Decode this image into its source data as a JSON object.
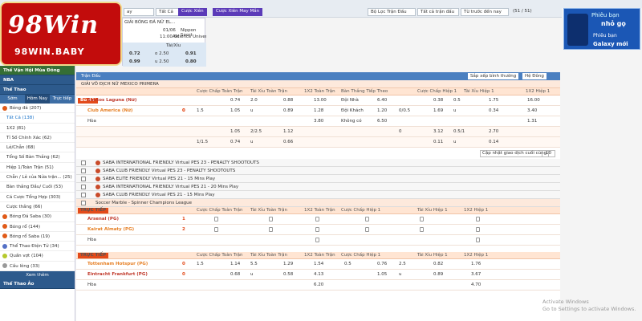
{
  "topbar": {
    "league_select": "Tất Cả",
    "btn_search": "Cược Xiên",
    "btn_mix": "Cược Xiên May Mắn",
    "filter_match": "Bộ Lọc Trận Đấu",
    "filter_all": "Tất cả trận đấu",
    "sort": "Từ trước đến nay",
    "count": "(51 / 51)",
    "label_ay": "ay"
  },
  "logo": {
    "text": "98Win",
    "domain": "98WIN.BABY"
  },
  "popup": {
    "league": "GIẢI BÓNG ĐÁ NỮ EL...",
    "date": "01/06",
    "time": "11:00AM",
    "team1": "Nippon Sport",
    "team2": "Science Universit...",
    "col2": "Tài/Xỉu",
    "r1a": "0.72",
    "r1b": "o 2.50",
    "r1c": "0.91",
    "r2a": "0.99",
    "r2b": "u 2.50",
    "r2c": "0.80"
  },
  "sidebar": {
    "h1": "Thế Vận Hội Mùa Đông",
    "h2": "NBA",
    "h3": "Thể Thao",
    "tabs": [
      "Sớm",
      "Hôm Nay",
      "Trực tiếp"
    ],
    "items": [
      "Bóng đá (207)",
      "Tất Cả (138)",
      "1X2 (81)",
      "Tỉ Số Chính Xác (62)",
      "Lẻ/Chẵn (68)",
      "Tổng Số Bàn Thắng (62)",
      "Hiệp 1/Toàn Trận (51)",
      "Chẵn / Lẻ của Nửa trận... (25)",
      "Bàn thắng Đầu/ Cuối (53)",
      "Cá Cược Tổng Hợp (303)",
      "Cược thắng (66)"
    ],
    "sports": [
      "Bóng Đá Saba (30)",
      "Bóng rổ (144)",
      "Bóng rổ Saba (19)",
      "Thể Thao Điện Tử (34)",
      "Quần vợt (104)",
      "Cầu lông (33)"
    ],
    "more": "Xem thêm",
    "bottom": "Thể Thao Ảo"
  },
  "main": {
    "section": "Trận Đấu",
    "sort_label": "Sắp xếp bình thường",
    "odds_label": "Hệ Đông",
    "league1": "GIẢI VÔ ĐỊCH NỮ MEXICO PRIMERA",
    "headers": [
      "Cược Chấp Toàn Trận",
      "Tài Xỉu Toàn Trận",
      "1X2 Toàn Trận",
      "Bàn Thắng Tiếp Theo",
      "Cược Chấp Hiệp 1",
      "Tài Xỉu Hiệp 1",
      "1X2 Hiệp 1"
    ],
    "match1": {
      "live": "Bù 41'",
      "home": "Santos Laguna (Nữ)",
      "away": "Club America (Nữ)",
      "draw": "Hòa",
      "score_home": "0",
      "score_away": "0",
      "r1": [
        "0.74",
        "2.0",
        "0.88",
        "13.00",
        "Đội Nhà",
        "6.40",
        "0.38",
        "0.5",
        "1.75",
        "16.00"
      ],
      "r2": [
        "1.5",
        "1.05",
        "u",
        "0.89",
        "1.28",
        "Đội Khách",
        "1.20",
        "0/0.5",
        "1.69",
        "u",
        "0.34",
        "3.40"
      ],
      "r3": [
        "3.80",
        "Không có",
        "6.50",
        "1.31"
      ],
      "r4": [
        "1.05",
        "2/2.5",
        "1.12",
        "0",
        "3.12",
        "0.5/1",
        "2.70"
      ],
      "r5": [
        "1/1.5",
        "0.74",
        "u",
        "0.66",
        "0.11",
        "u",
        "0.14"
      ]
    },
    "filter1": "Cập nhật giao dịch cuối cùng",
    "filter2": "10",
    "groups": [
      "SABA INTERNATIONAL FRIENDLY Virtual PES 23 - PENALTY SHOOTOUTS",
      "SABA CLUB FRIENDLY Virtual PES 23 - PENALTY SHOOTOUTS",
      "SABA ELITE FRIENDLY Virtual PES 21 - 15 Mins Play",
      "SABA INTERNATIONAL FRIENDLY Virtual PES 21 - 20 Mins Play",
      "SABA CLUB FRIENDLY Virtual PES 21 - 15 Mins Play",
      "Soccer Marble - Spinner Champions League"
    ],
    "match2": {
      "live": "TRỰC TIẾP",
      "home": "Arsenal (PG)",
      "away": "Kairat Almaty (PG)",
      "draw": "Hòa",
      "score_home": "1",
      "score_away": "2"
    },
    "match3": {
      "live": "TRỰC TIẾP",
      "home": "Tottenham Hotspur (PG)",
      "away": "Eintracht Frankfurt (PG)",
      "draw": "Hòa",
      "score_home": "0",
      "score_away": "0",
      "r1": [
        "1.5",
        "1.14",
        "5.5",
        "1.29",
        "1.54",
        "0.5",
        "0.76",
        "2.5",
        "0.82",
        "1.76"
      ],
      "r2": [
        "0.68",
        "u",
        "0.58",
        "4.13",
        "1.05",
        "u",
        "0.89",
        "3.67"
      ],
      "r3": [
        "6.20",
        "4.70"
      ]
    }
  },
  "banner": {
    "t1": "Phiêu bạn",
    "t2": "nhỏ gọ",
    "t3": "Phiêu bạn",
    "t4": "Galaxy mới"
  },
  "watermark": {
    "l1": "Activate Windows",
    "l2": "Go to Settings to activate Windows."
  }
}
